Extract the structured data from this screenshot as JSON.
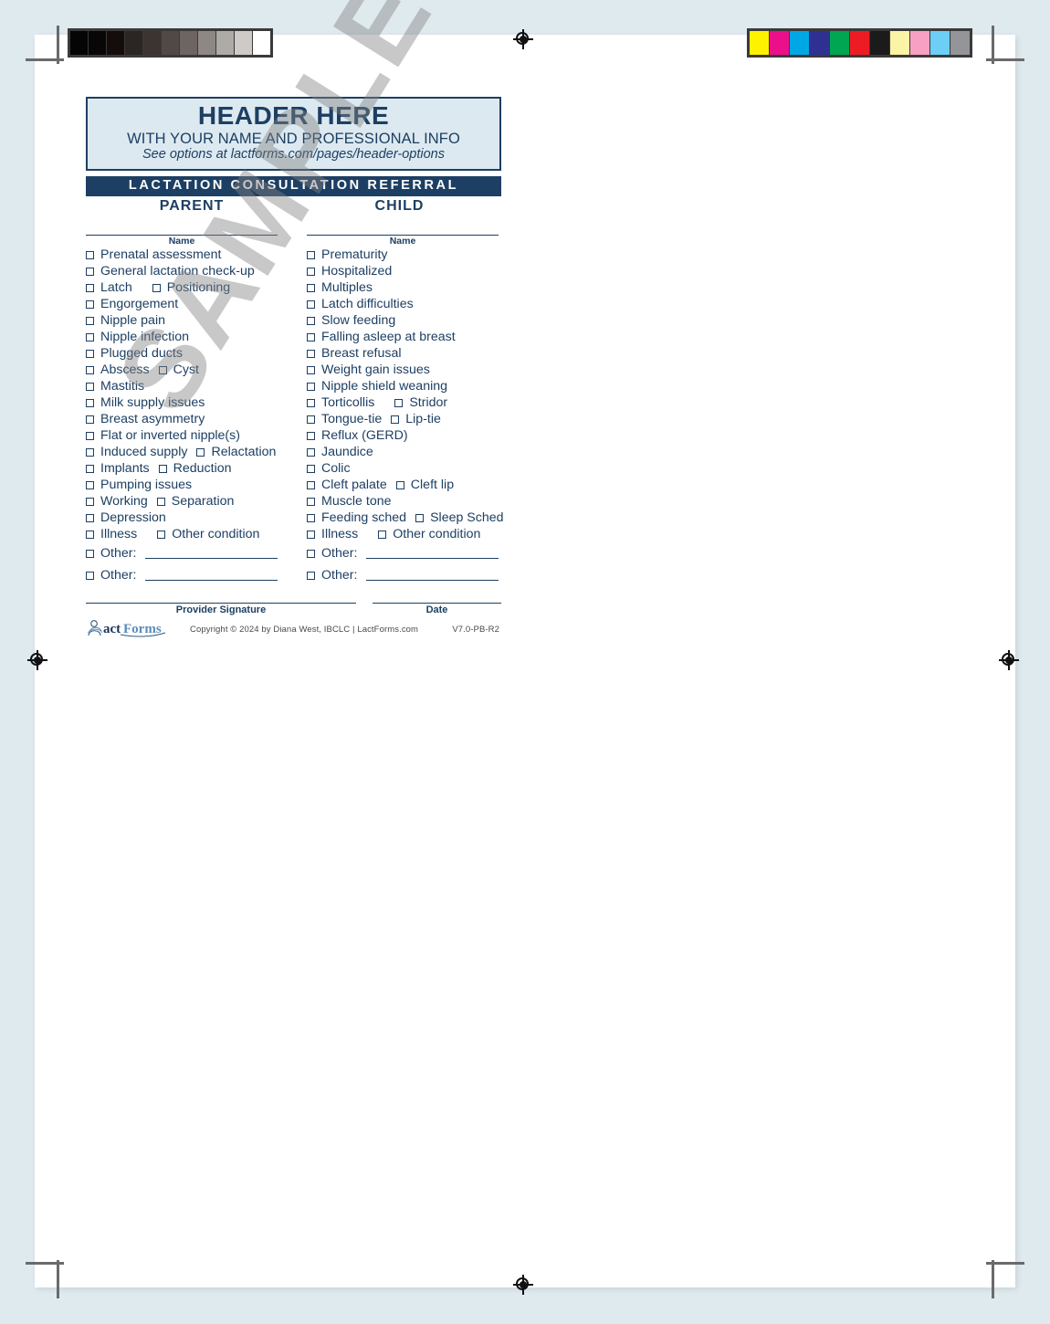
{
  "document": {
    "header": {
      "title": "HEADER HERE",
      "subtitle": "WITH YOUR NAME AND PROFESSIONAL INFO",
      "note": "See options at lactforms.com/pages/header-options"
    },
    "title_bar": "LACTATION CONSULTATION REFERRAL",
    "columns": {
      "parent": {
        "heading": "PARENT",
        "name_label": "Name",
        "items": [
          {
            "label": "Prenatal assessment"
          },
          {
            "label": "General lactation check-up"
          },
          {
            "label": "Latch",
            "second": "Positioning",
            "gap": "md"
          },
          {
            "label": "Engorgement"
          },
          {
            "label": "Nipple pain"
          },
          {
            "label": "Nipple infection"
          },
          {
            "label": "Plugged ducts"
          },
          {
            "label": "Abscess",
            "second": "Cyst",
            "gap": "sm"
          },
          {
            "label": "Mastitis"
          },
          {
            "label": "Milk supply issues"
          },
          {
            "label": "Breast asymmetry"
          },
          {
            "label": "Flat or inverted nipple(s)"
          },
          {
            "label": "Induced supply",
            "second": "Relactation",
            "gap": "sm"
          },
          {
            "label": "Implants",
            "second": "Reduction",
            "gap": "sm"
          },
          {
            "label": "Pumping issues"
          },
          {
            "label": "Working",
            "second": "Separation",
            "gap": "sm"
          },
          {
            "label": "Depression"
          },
          {
            "label": "Illness",
            "second": "Other condition",
            "gap": "md"
          }
        ],
        "other_rows": [
          {
            "label": "Other:",
            "value": ""
          },
          {
            "label": "Other:",
            "value": ""
          }
        ]
      },
      "child": {
        "heading": "CHILD",
        "name_label": "Name",
        "items": [
          {
            "label": "Prematurity"
          },
          {
            "label": "Hospitalized"
          },
          {
            "label": "Multiples"
          },
          {
            "label": "Latch difficulties"
          },
          {
            "label": "Slow feeding"
          },
          {
            "label": "Falling asleep at breast"
          },
          {
            "label": "Breast refusal"
          },
          {
            "label": "Weight gain issues"
          },
          {
            "label": "Nipple shield weaning"
          },
          {
            "label": "Torticollis",
            "second": "Stridor",
            "gap": "md"
          },
          {
            "label": "Tongue-tie",
            "second": "Lip-tie",
            "gap": "sm"
          },
          {
            "label": "Reflux (GERD)"
          },
          {
            "label": "Jaundice"
          },
          {
            "label": "Colic"
          },
          {
            "label": "Cleft palate",
            "second": "Cleft lip",
            "gap": "sm"
          },
          {
            "label": "Muscle tone"
          },
          {
            "label": "Feeding sched",
            "second": "Sleep Sched",
            "gap": "sm"
          },
          {
            "label": "Illness",
            "second": "Other condition",
            "gap": "md"
          }
        ],
        "other_rows": [
          {
            "label": "Other:",
            "value": ""
          },
          {
            "label": "Other:",
            "value": ""
          }
        ]
      }
    },
    "footer": {
      "provider_signature_label": "Provider Signature",
      "date_label": "Date",
      "logo_text": "LactForms",
      "copyright": "Copyright © 2024 by Diana West, IBCLC  |  LactForms.com",
      "version": "V7.0-PB-R2"
    },
    "watermark": "SAMPLE"
  },
  "colors": {
    "brand_navy": "#1d3f63",
    "header_fill": "#dde9f0",
    "page_background": "#dfeaef",
    "paper": "#ffffff",
    "watermark_gray": "#828282"
  },
  "calibration": {
    "grayscale_label": "grayscale-step-wedge",
    "grayscale_swatches": [
      "#050505",
      "#080606",
      "#140d0c",
      "#2b2523",
      "#3b3431",
      "#514946",
      "#6d6562",
      "#8e8884",
      "#aeaaa6",
      "#cdcac7",
      "#ffffff"
    ],
    "color_label": "color-control-bar",
    "color_swatches": [
      "#fff200",
      "#ec0f8c",
      "#00a7e5",
      "#2e3192",
      "#00a651",
      "#ed1c24",
      "#1b1b1b",
      "#fbf3a5",
      "#f8a0c4",
      "#6dcff6",
      "#939598"
    ]
  },
  "print_marks": {
    "registration_mark_label": "registration-target",
    "crop_mark_label": "crop-mark"
  }
}
